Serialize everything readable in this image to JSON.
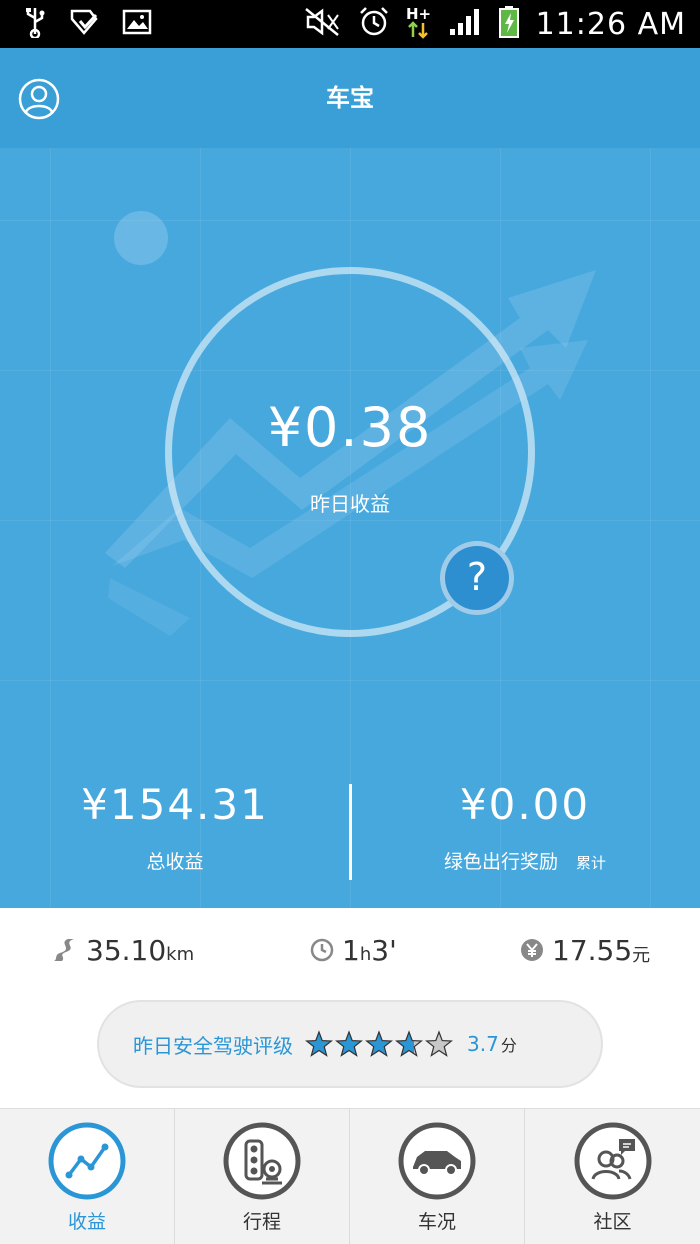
{
  "status_bar": {
    "time": "11:26 AM",
    "network": "H+",
    "icons": [
      "usb-icon",
      "app-notification-icon",
      "image-notification-icon",
      "mute-icon",
      "alarm-icon",
      "network-h-plus-icon",
      "signal-icon",
      "battery-charging-icon"
    ]
  },
  "header": {
    "title": "车宝",
    "profile_icon": "user-icon"
  },
  "hero": {
    "yesterday_amount": "¥0.38",
    "yesterday_label": "昨日收益",
    "help_symbol": "?"
  },
  "stats": {
    "total_amount": "¥154.31",
    "total_label": "总收益",
    "green_amount": "¥0.00",
    "green_label": "绿色出行奖励",
    "green_sub": "累计"
  },
  "metrics": {
    "distance_value": "35.10",
    "distance_unit": "km",
    "duration_h": "1",
    "duration_h_unit": "h",
    "duration_m": "3'",
    "money_value": "17.55",
    "money_unit": "元"
  },
  "rating": {
    "label": "昨日安全驾驶评级",
    "score": "3.7",
    "unit": "分",
    "stars_filled": 3.7,
    "stars_total": 5
  },
  "bottom_nav": [
    {
      "label": "收益",
      "icon": "chart-trend-icon",
      "active": true
    },
    {
      "label": "行程",
      "icon": "traffic-light-icon",
      "active": false
    },
    {
      "label": "车况",
      "icon": "car-icon",
      "active": false
    },
    {
      "label": "社区",
      "icon": "community-icon",
      "active": false
    }
  ],
  "colors": {
    "primary": "#3a9fd6",
    "hero_bg": "#47a8de",
    "accent_text": "#2a96d6"
  }
}
